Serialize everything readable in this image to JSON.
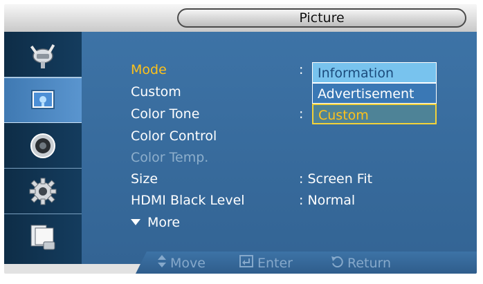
{
  "header": {
    "title": "Picture"
  },
  "sidebar": {
    "items": [
      {
        "icon": "plug-icon"
      },
      {
        "icon": "picture-icon",
        "active": true
      },
      {
        "icon": "speaker-icon"
      },
      {
        "icon": "gear-icon"
      },
      {
        "icon": "multi-screen-icon"
      }
    ]
  },
  "menu": {
    "items": [
      {
        "label": "Mode",
        "value": ":"
      },
      {
        "label": "Custom",
        "value": ""
      },
      {
        "label": "Color Tone",
        "value": ":"
      },
      {
        "label": "Color Control",
        "value": ""
      },
      {
        "label": "Color Temp.",
        "value": ""
      },
      {
        "label": "Size",
        "value": ": Screen Fit"
      },
      {
        "label": "HDMI Black Level",
        "value": ": Normal"
      }
    ],
    "more_label": "More"
  },
  "dropdown": {
    "options": [
      "Information",
      "Advertisement",
      "Custom"
    ],
    "selected": "Custom"
  },
  "footer": {
    "move_label": "Move",
    "enter_label": "Enter",
    "return_label": "Return"
  },
  "colors": {
    "selected_text": "#ffc21a",
    "panel_blue": "#3d73a6",
    "sidebar_dark": "#0e2d47"
  }
}
